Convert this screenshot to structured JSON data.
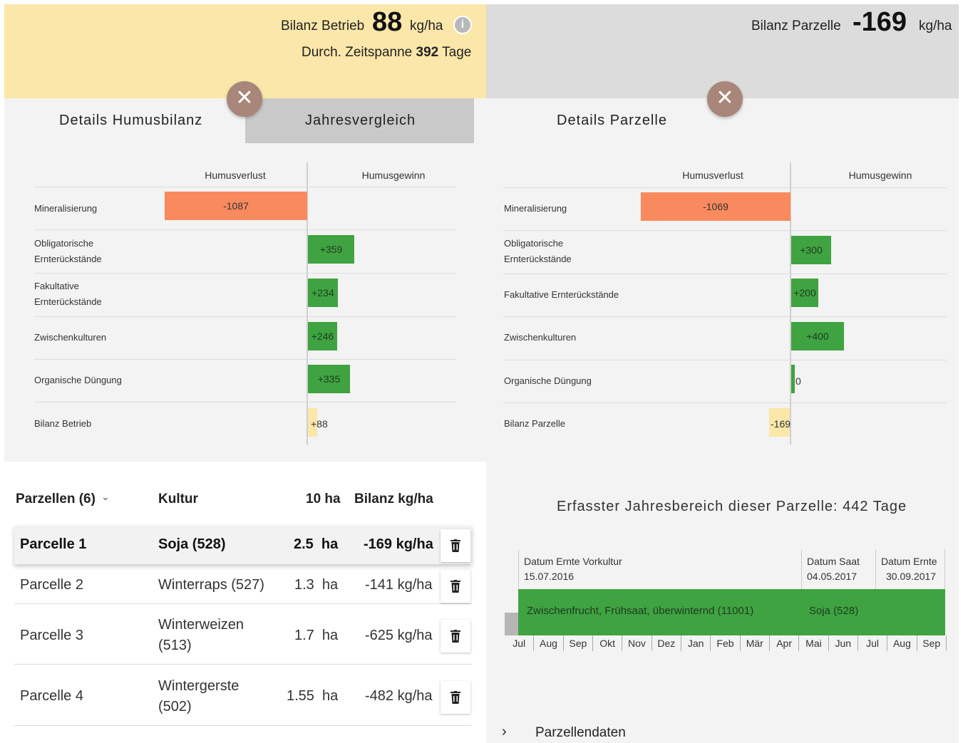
{
  "left": {
    "header": {
      "balance_label": "Bilanz Betrieb",
      "balance_value": "88",
      "unit": "kg/ha",
      "period_prefix": "Durch. Zeitspanne",
      "period_value": "392",
      "period_unit": "Tage"
    },
    "tabs": [
      {
        "label": "Details Humusbilanz",
        "active": true
      },
      {
        "label": "Jahresvergleich",
        "active": false
      }
    ],
    "chart": {
      "col_loss": "Humusverlust",
      "col_gain": "Humusgewinn",
      "rows": [
        {
          "label": "Mineralisierung",
          "value": "-1087"
        },
        {
          "label": "Obligatorische Ernterückstände",
          "value": "+359"
        },
        {
          "label": "Fakultative Ernterückstände",
          "value": "+234"
        },
        {
          "label": "Zwischenkulturen",
          "value": "+246"
        },
        {
          "label": "Organische Düngung",
          "value": "+335"
        },
        {
          "label": "Bilanz Betrieb",
          "value": "+88"
        }
      ]
    },
    "list": {
      "headers": {
        "plots": "Parzellen (6)",
        "crop": "Kultur",
        "area": "10 ha",
        "balance": "Bilanz kg/ha"
      },
      "rows": [
        {
          "name": "Parcelle 1",
          "crop": "Soja (528)",
          "area": "2.5  ha",
          "balance": "-169 kg/ha",
          "selected": true
        },
        {
          "name": "Parcelle 2",
          "crop": "Winterraps (527)",
          "area": "1.3  ha",
          "balance": "-141 kg/ha"
        },
        {
          "name": "Parcelle 3",
          "crop_line1": "Winterweizen",
          "crop_line2": "(513)",
          "area": "1.7  ha",
          "balance": "-625 kg/ha"
        },
        {
          "name": "Parcelle 4",
          "crop_line1": "Wintergerste",
          "crop_line2": "(502)",
          "area": "1.55  ha",
          "balance": "-482 kg/ha"
        }
      ]
    }
  },
  "right": {
    "header": {
      "balance_label": "Bilanz Parzelle",
      "balance_value": "-169",
      "unit": "kg/ha"
    },
    "title": "Details Parzelle",
    "chart": {
      "col_loss": "Humusverlust",
      "col_gain": "Humusgewinn",
      "rows": [
        {
          "label": "Mineralisierung",
          "value": "-1069"
        },
        {
          "label": "Obligatorische Ernterückstände",
          "value": "+300"
        },
        {
          "label": "Fakultative Ernterückstände",
          "value": "+200"
        },
        {
          "label": "Zwischenkulturen",
          "value": "+400"
        },
        {
          "label": "Organische Düngung",
          "value": "0"
        },
        {
          "label": "Bilanz Parzelle",
          "value": "-169"
        }
      ]
    },
    "timeline": {
      "title": "Erfasster Jahresbereich dieser Parzelle: 442 Tage",
      "prev_harvest_label": "Datum Ernte Vorkultur",
      "prev_harvest_date": "15.07.2016",
      "sow_label": "Datum Saat",
      "sow_date": "04.05.2017",
      "harvest_label": "Datum Ernte",
      "harvest_date": "30.09.2017",
      "catch_crop": "Zwischenfrucht, Frühsaat, überwinternd (11001)",
      "main_crop": "Soja (528)",
      "months": [
        "Jul",
        "Aug",
        "Sep",
        "Okt",
        "Nov",
        "Dez",
        "Jan",
        "Feb",
        "Mär",
        "Apr",
        "Mai",
        "Jun",
        "Jul",
        "Aug",
        "Sep"
      ]
    },
    "plot_data_link": "Parzellendaten"
  },
  "colors": {
    "loss": "#f98a5e",
    "gain": "#3fa342",
    "balance": "#fbe7a9",
    "header_left": "#fbe7a9",
    "header_right": "#dcdcdc",
    "close": "#a88679"
  }
}
